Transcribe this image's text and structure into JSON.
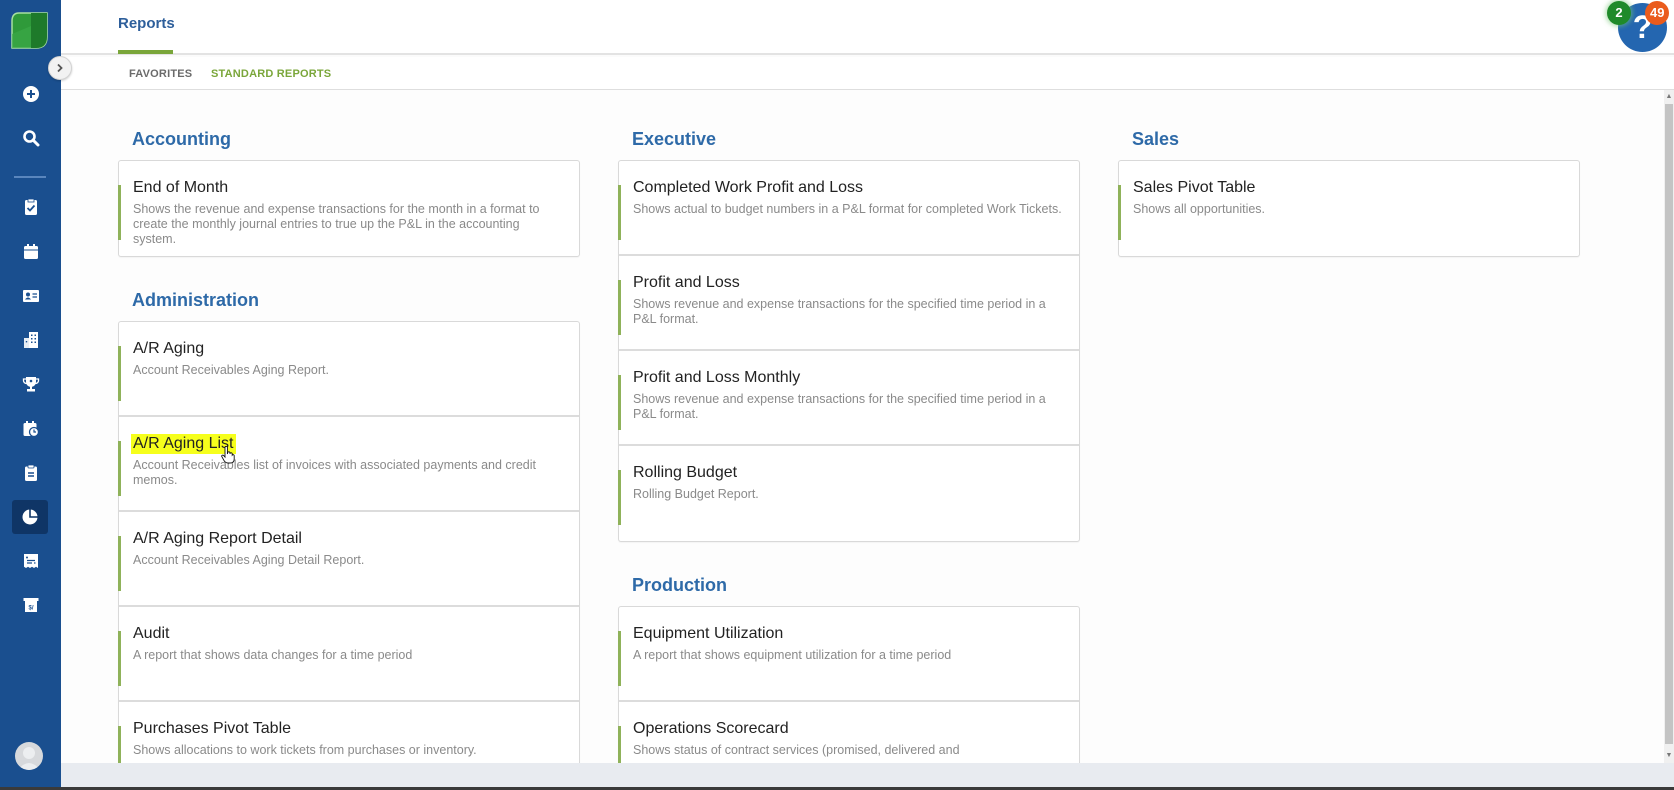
{
  "app": {
    "brand_colors": {
      "sidebar": "#1a4f8f",
      "accent_green": "#7aa63a",
      "heading_blue": "#2e6aa8",
      "highlight": "#f6ff1c"
    }
  },
  "sidebar": {
    "items": [
      {
        "name": "add",
        "icon": "plus-circle-icon"
      },
      {
        "name": "search",
        "icon": "search-icon"
      },
      {
        "name": "tasks",
        "icon": "clipboard-check-icon"
      },
      {
        "name": "calendar",
        "icon": "calendar-icon"
      },
      {
        "name": "contacts",
        "icon": "contact-card-icon"
      },
      {
        "name": "properties",
        "icon": "building-icon"
      },
      {
        "name": "opportunities",
        "icon": "trophy-icon"
      },
      {
        "name": "schedule",
        "icon": "calendar-clock-icon"
      },
      {
        "name": "work-tickets",
        "icon": "clipboard-list-icon"
      },
      {
        "name": "reports",
        "icon": "pie-chart-icon",
        "active": true
      },
      {
        "name": "invoices",
        "icon": "receipt-icon"
      },
      {
        "name": "billing",
        "icon": "cash-register-icon"
      }
    ],
    "avatar": "user-avatar"
  },
  "header": {
    "page_tab": "Reports",
    "help": {
      "label": "?",
      "green_badge": "2",
      "orange_badge": "49"
    }
  },
  "subtabs": {
    "favorites": "FAVORITES",
    "standard_reports": "STANDARD REPORTS",
    "active": "STANDARD REPORTS"
  },
  "sections": {
    "accounting": {
      "title": "Accounting",
      "reports": [
        {
          "title": "End of Month",
          "desc": "Shows the revenue and expense transactions for the month in a format to create the monthly journal entries to true up the P&L in the accounting system."
        }
      ]
    },
    "administration": {
      "title": "Administration",
      "reports": [
        {
          "title": "A/R Aging",
          "desc": "Account Receivables Aging Report."
        },
        {
          "title": "A/R Aging List",
          "desc": "Account Receivables list of invoices with associated payments and credit memos."
        },
        {
          "title": "A/R Aging Report Detail",
          "desc": "Account Receivables Aging Detail Report."
        },
        {
          "title": "Audit",
          "desc": "A report that shows data changes for a time period"
        },
        {
          "title": "Purchases Pivot Table",
          "desc": "Shows allocations to work tickets from purchases or inventory."
        }
      ]
    },
    "executive": {
      "title": "Executive",
      "reports": [
        {
          "title": "Completed Work Profit and Loss",
          "desc": "Shows actual to budget numbers in a P&L format for completed Work Tickets."
        },
        {
          "title": "Profit and Loss",
          "desc": "Shows revenue and expense transactions for the specified time period in a P&L format."
        },
        {
          "title": "Profit and Loss Monthly",
          "desc": "Shows revenue and expense transactions for the specified time period in a P&L format."
        },
        {
          "title": "Rolling Budget",
          "desc": "Rolling Budget Report."
        }
      ]
    },
    "production": {
      "title": "Production",
      "reports": [
        {
          "title": "Equipment Utilization",
          "desc": "A report that shows equipment utilization for a time period"
        },
        {
          "title": "Operations Scorecard",
          "desc": "Shows status of contract services (promised, delivered and"
        }
      ]
    },
    "sales": {
      "title": "Sales",
      "reports": [
        {
          "title": "Sales Pivot Table",
          "desc": "Shows all opportunities."
        }
      ]
    }
  },
  "highlighted_report": "A/R Aging List"
}
